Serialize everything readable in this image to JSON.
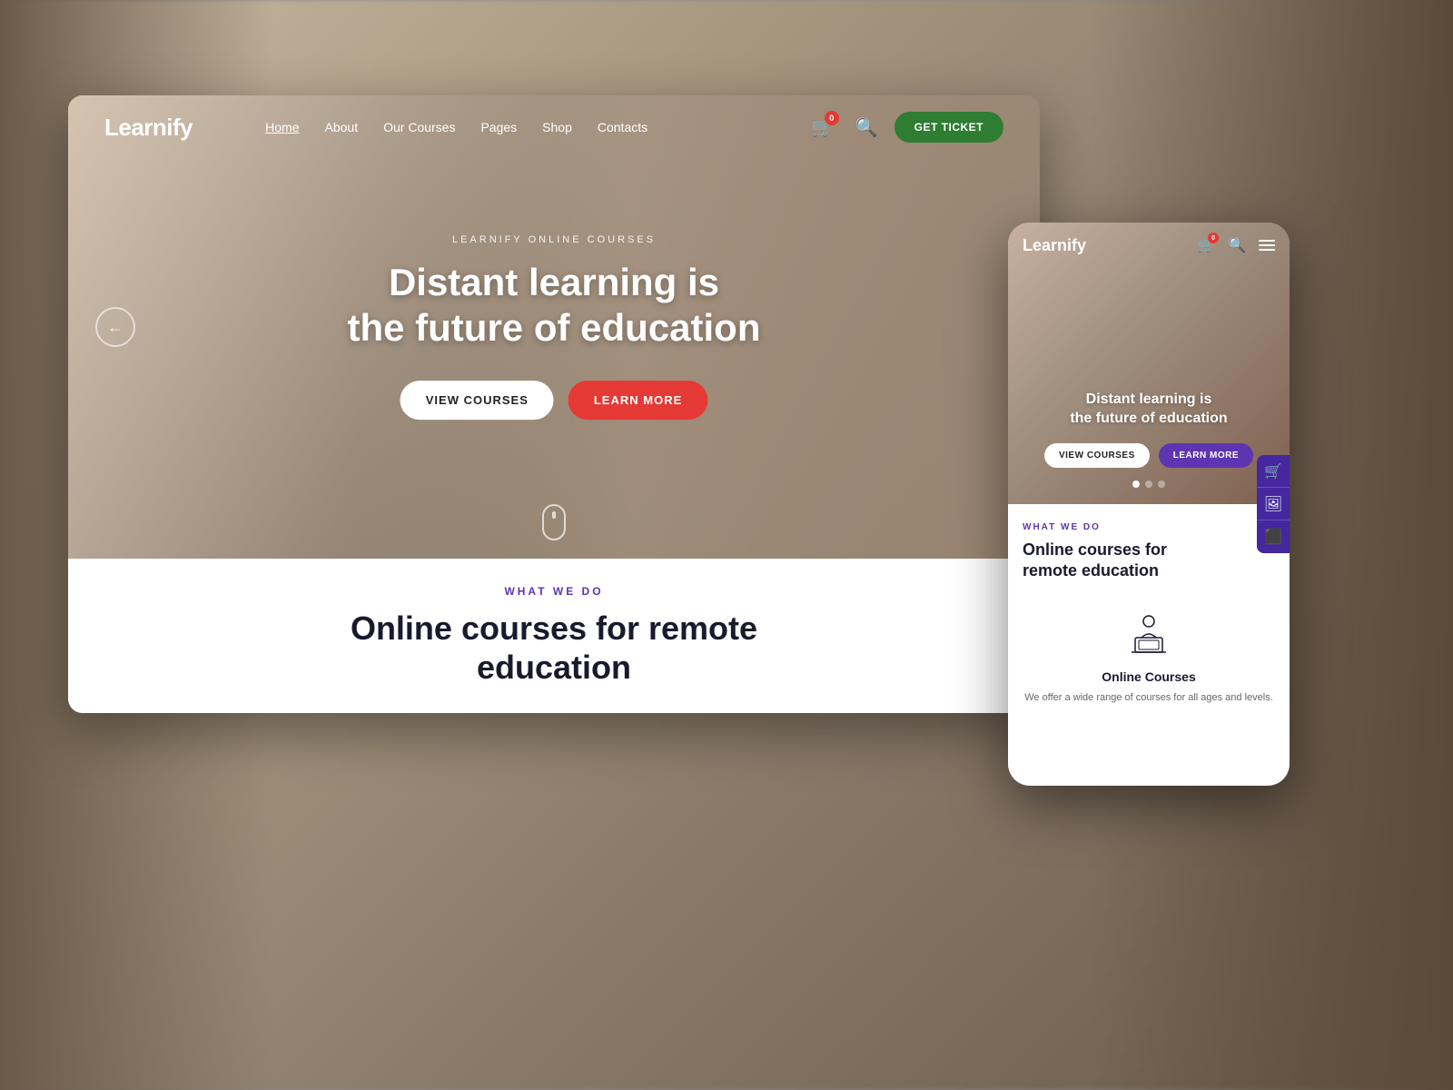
{
  "background": {
    "gradient": "linear-gradient(135deg, #c8b8a2, #a89880, #8a7a6a, #6a5a4a)"
  },
  "desktop": {
    "nav": {
      "logo": "Learnify",
      "links": [
        {
          "label": "Home",
          "active": true
        },
        {
          "label": "About",
          "active": false
        },
        {
          "label": "Our Courses",
          "active": false
        },
        {
          "label": "Pages",
          "active": false
        },
        {
          "label": "Shop",
          "active": false
        },
        {
          "label": "Contacts",
          "active": false
        }
      ],
      "cart_count": "0",
      "get_ticket_label": "GET TICKET"
    },
    "hero": {
      "subtitle": "LEARNIFY ONLINE COURSES",
      "title": "Distant learning is\nthe future of education",
      "btn_view_courses": "VIEW COURSES",
      "btn_learn_more": "LEARN MORE"
    },
    "bottom": {
      "what_we_do": "WHAT WE DO",
      "title_line1": "Online courses for remote",
      "title_line2": "education"
    }
  },
  "mobile": {
    "nav": {
      "logo": "Learnify",
      "cart_count": "0"
    },
    "hero": {
      "title": "Distant learning is\nthe future of education",
      "btn_view_courses": "VIEW COURSES",
      "btn_learn_more": "LEARN MORE"
    },
    "bottom": {
      "what_we_do": "WHAT WE DO",
      "title": "Online courses for\nremote education",
      "course_icon_label": "Online Courses",
      "course_icon_desc": "We offer a wide range of courses for all ages and levels."
    }
  },
  "colors": {
    "accent_purple": "#5e35b1",
    "accent_red": "#e53935",
    "accent_green": "#2e7d32",
    "dark_blue": "#1a1a2e",
    "white": "#ffffff"
  }
}
